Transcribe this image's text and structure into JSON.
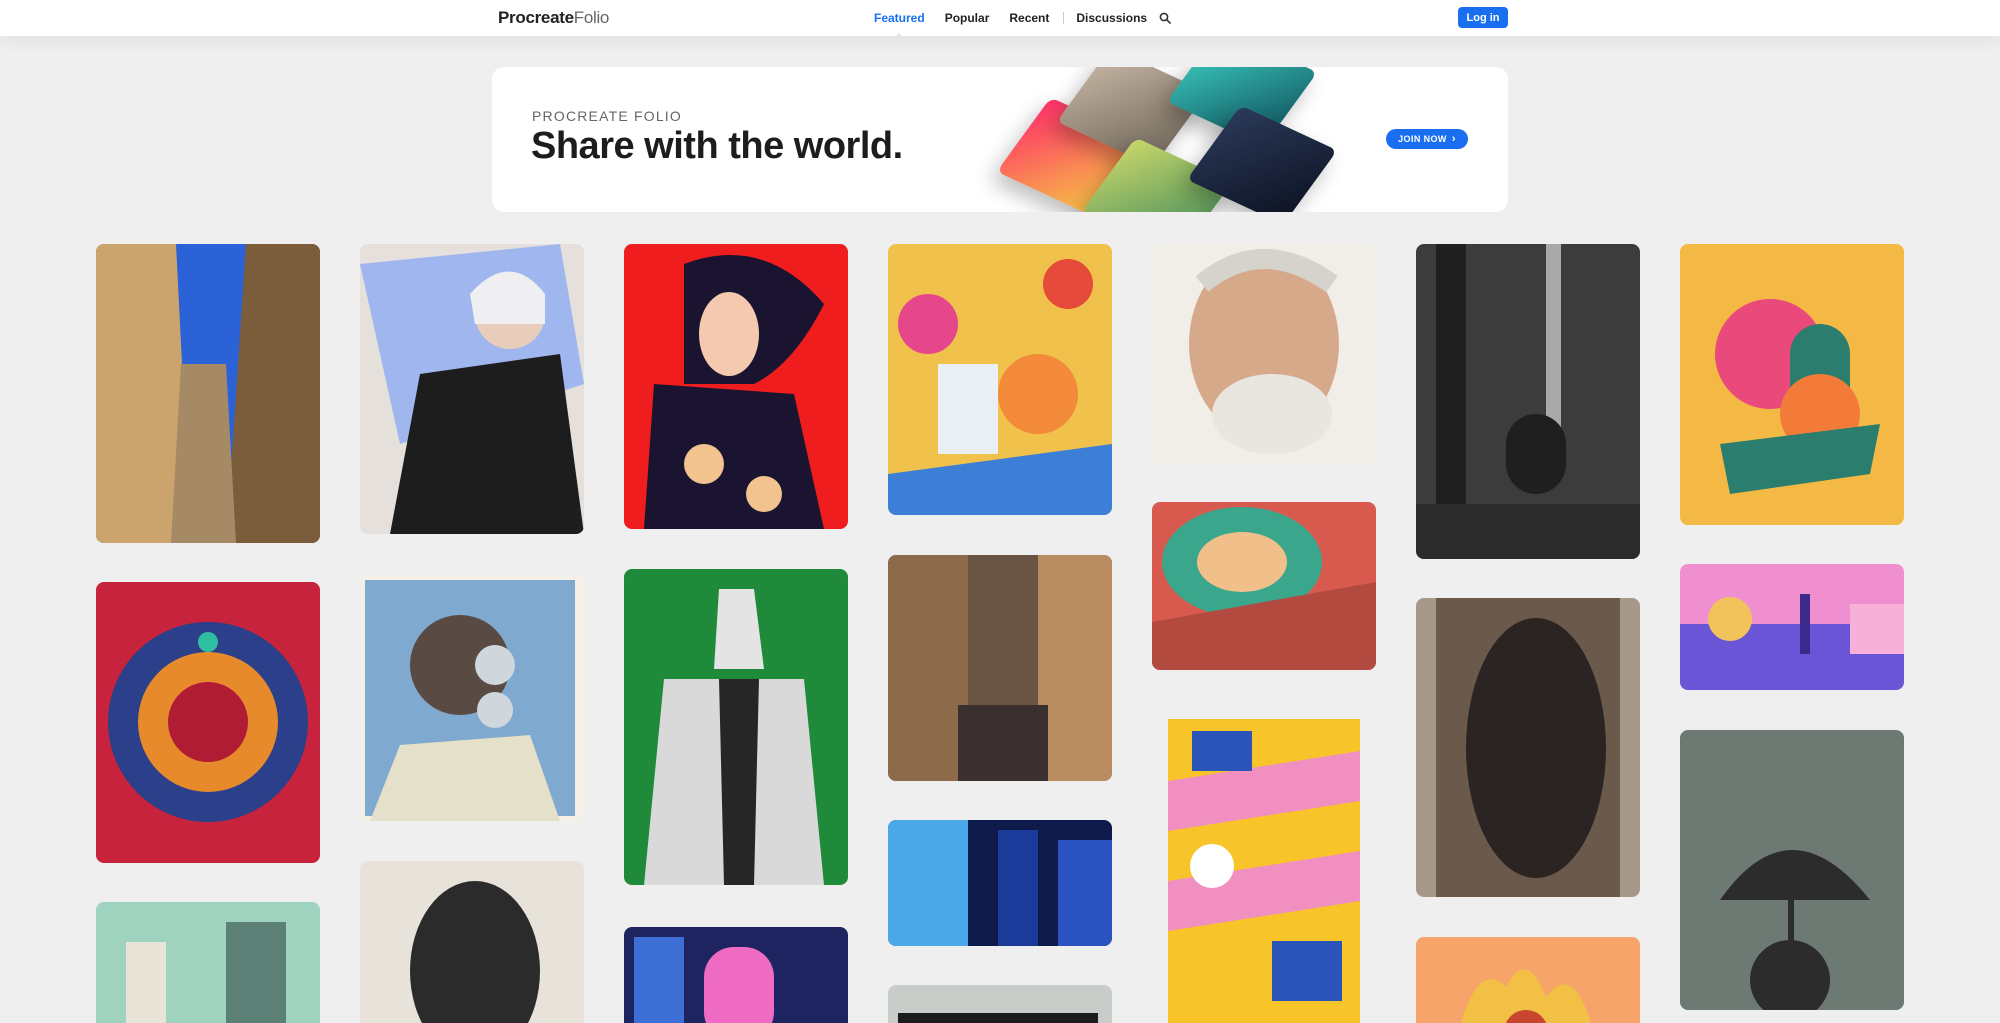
{
  "header": {
    "logo_bold": "Procreate",
    "logo_light": "Folio",
    "nav": [
      {
        "label": "Featured",
        "active": true
      },
      {
        "label": "Popular",
        "active": false
      },
      {
        "label": "Recent",
        "active": false
      },
      {
        "label": "Discussions",
        "active": false
      }
    ],
    "login_label": "Log in"
  },
  "banner": {
    "eyebrow": "PROCREATE FOLIO",
    "title": "Share with the world.",
    "cta_label": "JOIN NOW",
    "cta_chevron": "›"
  },
  "colors": {
    "accent": "#1a6ff0",
    "background": "#efefef"
  },
  "gallery": {
    "artworks": [
      {
        "name": "sunlit-alley",
        "palette": [
          "#c9a46a",
          "#6b4f34",
          "#2b6be0"
        ]
      },
      {
        "name": "woman-in-painted-jacket",
        "palette": [
          "#9fb6ef",
          "#1d1d1d",
          "#e6e0dc"
        ]
      },
      {
        "name": "woman-red-background",
        "palette": [
          "#ef1d1d",
          "#1b1430",
          "#f2c38f"
        ]
      },
      {
        "name": "picnic-table-spread",
        "palette": [
          "#f0c24b",
          "#e6468a",
          "#3d7fd6"
        ]
      },
      {
        "name": "old-man-portrait",
        "palette": [
          "#d6c8b8",
          "#8a7360",
          "#f1ede7"
        ]
      },
      {
        "name": "dark-forest-gate",
        "palette": [
          "#3c3c3c",
          "#8d8d8d",
          "#1f1f1f"
        ]
      },
      {
        "name": "abstract-shapes-yellow",
        "palette": [
          "#f4b944",
          "#e94a7b",
          "#2b7d6d"
        ]
      },
      {
        "name": "psychedelic-meditation",
        "palette": [
          "#c8233c",
          "#2b3f8a",
          "#e78a2b"
        ]
      },
      {
        "name": "girl-with-goggles",
        "palette": [
          "#7fa9cf",
          "#5a4a44",
          "#e5e0c9"
        ]
      },
      {
        "name": "geometric-suited-figure",
        "palette": [
          "#1e8a3a",
          "#e4e4e4",
          "#262626"
        ]
      },
      {
        "name": "rainy-street-painting",
        "palette": [
          "#6a5444",
          "#b98d5f",
          "#3b3030"
        ]
      },
      {
        "name": "subway-tunnel",
        "palette": [
          "#d85a4f",
          "#3aa68b",
          "#f1c08a"
        ]
      },
      {
        "name": "dark-figure-painting",
        "palette": [
          "#2a2522",
          "#6b5a4c",
          "#a7998a"
        ]
      },
      {
        "name": "city-fountain-pink",
        "palette": [
          "#f08fd0",
          "#6a55d6",
          "#f3c35b"
        ]
      },
      {
        "name": "alley-mint-wall",
        "palette": [
          "#9fd3c0",
          "#e9e4d8",
          "#5c8076"
        ]
      },
      {
        "name": "child-silhouette-portrait",
        "palette": [
          "#e7e3da",
          "#2b2b2b",
          "#8c8c8c"
        ]
      },
      {
        "name": "neon-doorway",
        "palette": [
          "#3d6fd6",
          "#f06bc3",
          "#1d2460"
        ]
      },
      {
        "name": "aquarium-blue",
        "palette": [
          "#1b3a9a",
          "#4aa7e8",
          "#0d1a4a"
        ]
      },
      {
        "name": "easy-breezy-poster",
        "palette": [
          "#f7c42a",
          "#2b54b8",
          "#f08fc0"
        ]
      },
      {
        "name": "orange-hands",
        "palette": [
          "#f7a46a",
          "#f1c045",
          "#c8452e"
        ]
      },
      {
        "name": "umbrella-reflection",
        "palette": [
          "#6d7a73",
          "#2c2c2c",
          "#8b9890"
        ]
      },
      {
        "name": "framed-painting",
        "palette": [
          "#c9cdc9",
          "#1c1c1c",
          "#e8e8e8"
        ]
      }
    ]
  }
}
